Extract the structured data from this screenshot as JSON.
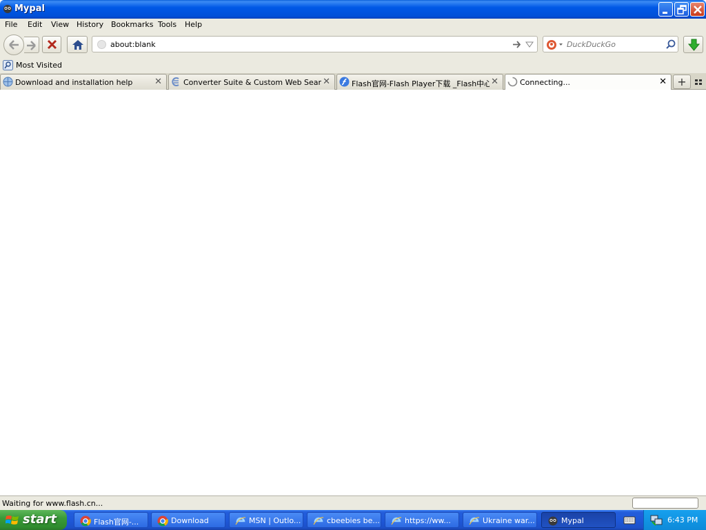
{
  "window": {
    "title": "Mypal"
  },
  "menu": [
    "File",
    "Edit",
    "View",
    "History",
    "Bookmarks",
    "Tools",
    "Help"
  ],
  "url": {
    "value": "about:blank"
  },
  "search": {
    "placeholder": "DuckDuckGo"
  },
  "bookmarks": {
    "most_visited": "Most Visited"
  },
  "tabs": [
    {
      "label": "Download and installation help",
      "icon": "help-globe-icon"
    },
    {
      "label": "Converter Suite & Custom Web Search",
      "icon": "converter-icon"
    },
    {
      "label": "Flash官网-Flash Player下载 _Flash中心",
      "icon": "flash-icon"
    },
    {
      "label": "Connecting...",
      "icon": "loading-spinner-icon",
      "active": true
    }
  ],
  "status": {
    "text": "Waiting for www.flash.cn..."
  },
  "taskbar": {
    "start": "start",
    "items": [
      {
        "label": "Flash官网-...",
        "icon": "chrome-icon"
      },
      {
        "label": "Download",
        "icon": "chrome-icon"
      },
      {
        "label": "MSN | Outlo...",
        "icon": "ie-icon"
      },
      {
        "label": "cbeebies be...",
        "icon": "ie-icon"
      },
      {
        "label": "https://ww...",
        "icon": "ie-icon"
      },
      {
        "label": "Ukraine war...",
        "icon": "ie-icon"
      },
      {
        "label": "Mypal",
        "icon": "mypal-icon",
        "active": true
      }
    ],
    "clock": "6:43 PM"
  },
  "colors": {
    "titlebar": "#0058e6",
    "taskbar": "#245edb",
    "start": "#3a9a39",
    "tray": "#0d8ad9"
  }
}
